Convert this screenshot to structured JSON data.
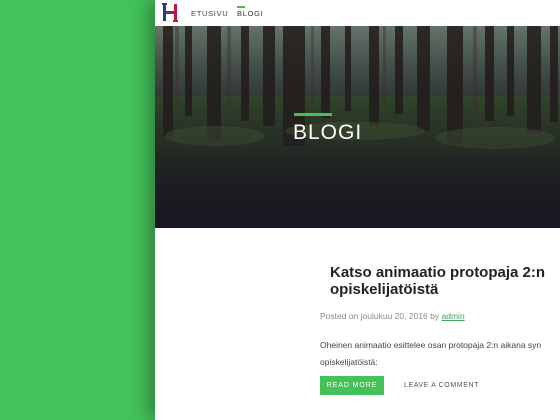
{
  "nav": {
    "logo_icon": "h-logo-icon",
    "items": [
      {
        "label": "ETUSIVU",
        "active": false
      },
      {
        "label": "BLOGI",
        "active": true
      }
    ]
  },
  "hero": {
    "title": "BLOGI",
    "background": "forest-image"
  },
  "post": {
    "title": "Katso animaatio protopaja 2:n opiskelijatöistä",
    "meta_prefix": "Posted on",
    "date": "joulukuu 20, 2016",
    "meta_by": "by",
    "author": "admin",
    "excerpt_line1": "Oheinen animaatio esittelee osan protopaja 2:n aikana syn",
    "excerpt_line2": "opiskelijatöistä:",
    "read_more_label": "READ MORE",
    "leave_comment_label": "LEAVE A COMMENT"
  },
  "colors": {
    "accent": "#43c25a",
    "background_left": "#43c25a",
    "hero_dark": "#1b1a22"
  }
}
